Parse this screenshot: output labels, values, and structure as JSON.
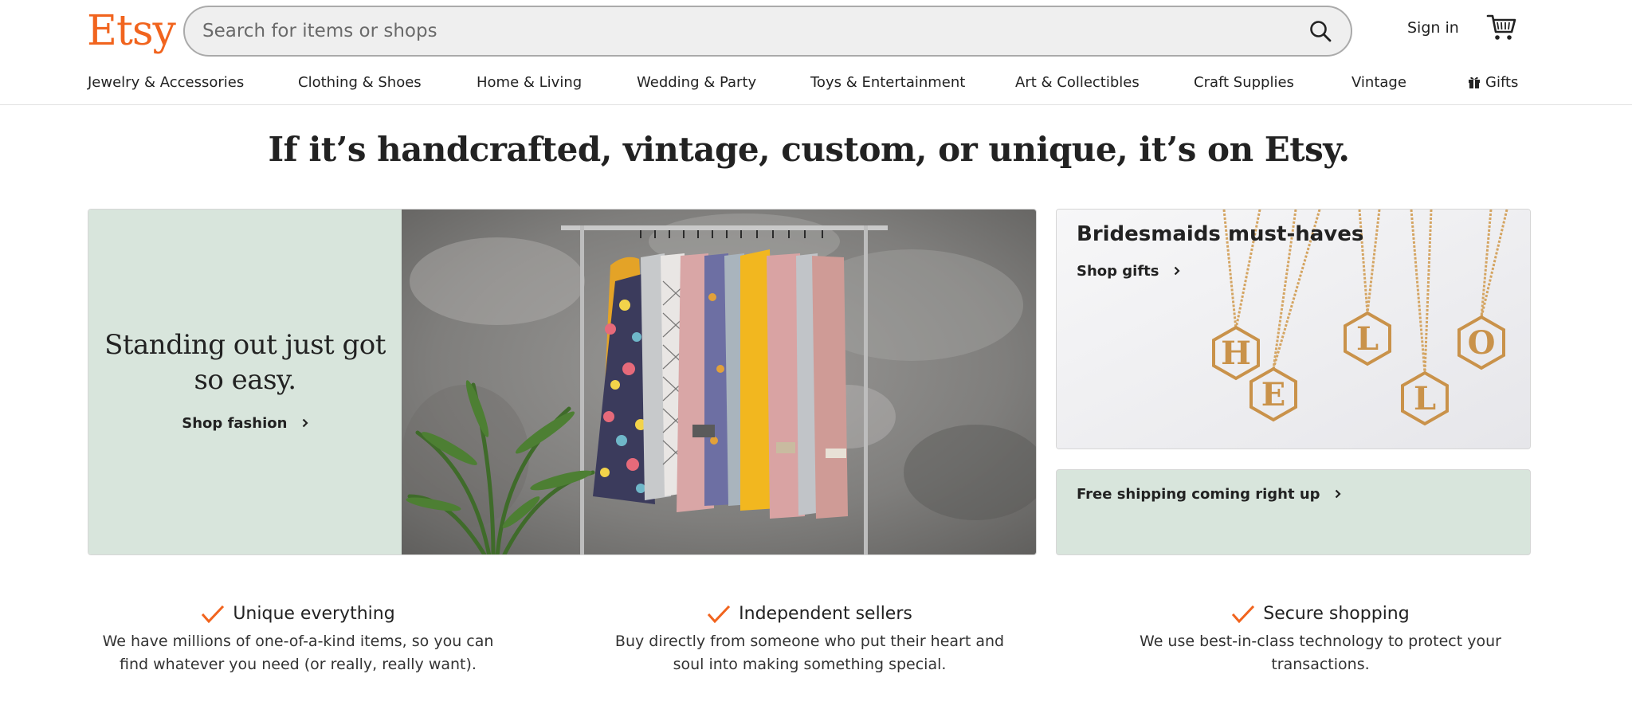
{
  "header": {
    "logo": "Etsy",
    "search_placeholder": "Search for items or shops",
    "sign_in": "Sign in"
  },
  "nav": {
    "items": [
      "Jewelry & Accessories",
      "Clothing & Shoes",
      "Home & Living",
      "Wedding & Party",
      "Toys & Entertainment",
      "Art & Collectibles",
      "Craft Supplies",
      "Vintage",
      "Gifts"
    ]
  },
  "headline": "If it’s handcrafted, vintage, custom, or unique, it’s on Etsy.",
  "hero": {
    "title": "Standing out just got so easy.",
    "link": "Shop fashion"
  },
  "promo_bridesmaids": {
    "title": "Bridesmaids must-haves",
    "link": "Shop gifts",
    "pendant_letters": [
      "H",
      "E",
      "L",
      "L",
      "O"
    ]
  },
  "promo_shipping": {
    "link": "Free shipping coming right up"
  },
  "value_props": [
    {
      "title": "Unique everything",
      "description": "We have millions of one-of-a-kind items, so you can find whatever you need (or really, really want)."
    },
    {
      "title": "Independent sellers",
      "description": "Buy directly from someone who put their heart and soul into making something special."
    },
    {
      "title": "Secure shopping",
      "description": "We use best-in-class technology to protect your transactions."
    }
  ],
  "colors": {
    "brand": "#f1641e",
    "promo_green": "#d8e5dc",
    "check": "#f1641e"
  },
  "icons": {
    "search": "search-icon",
    "cart": "cart-icon",
    "gift": "gift-icon",
    "chevron": "chevron-right-icon",
    "check": "checkmark-icon"
  }
}
